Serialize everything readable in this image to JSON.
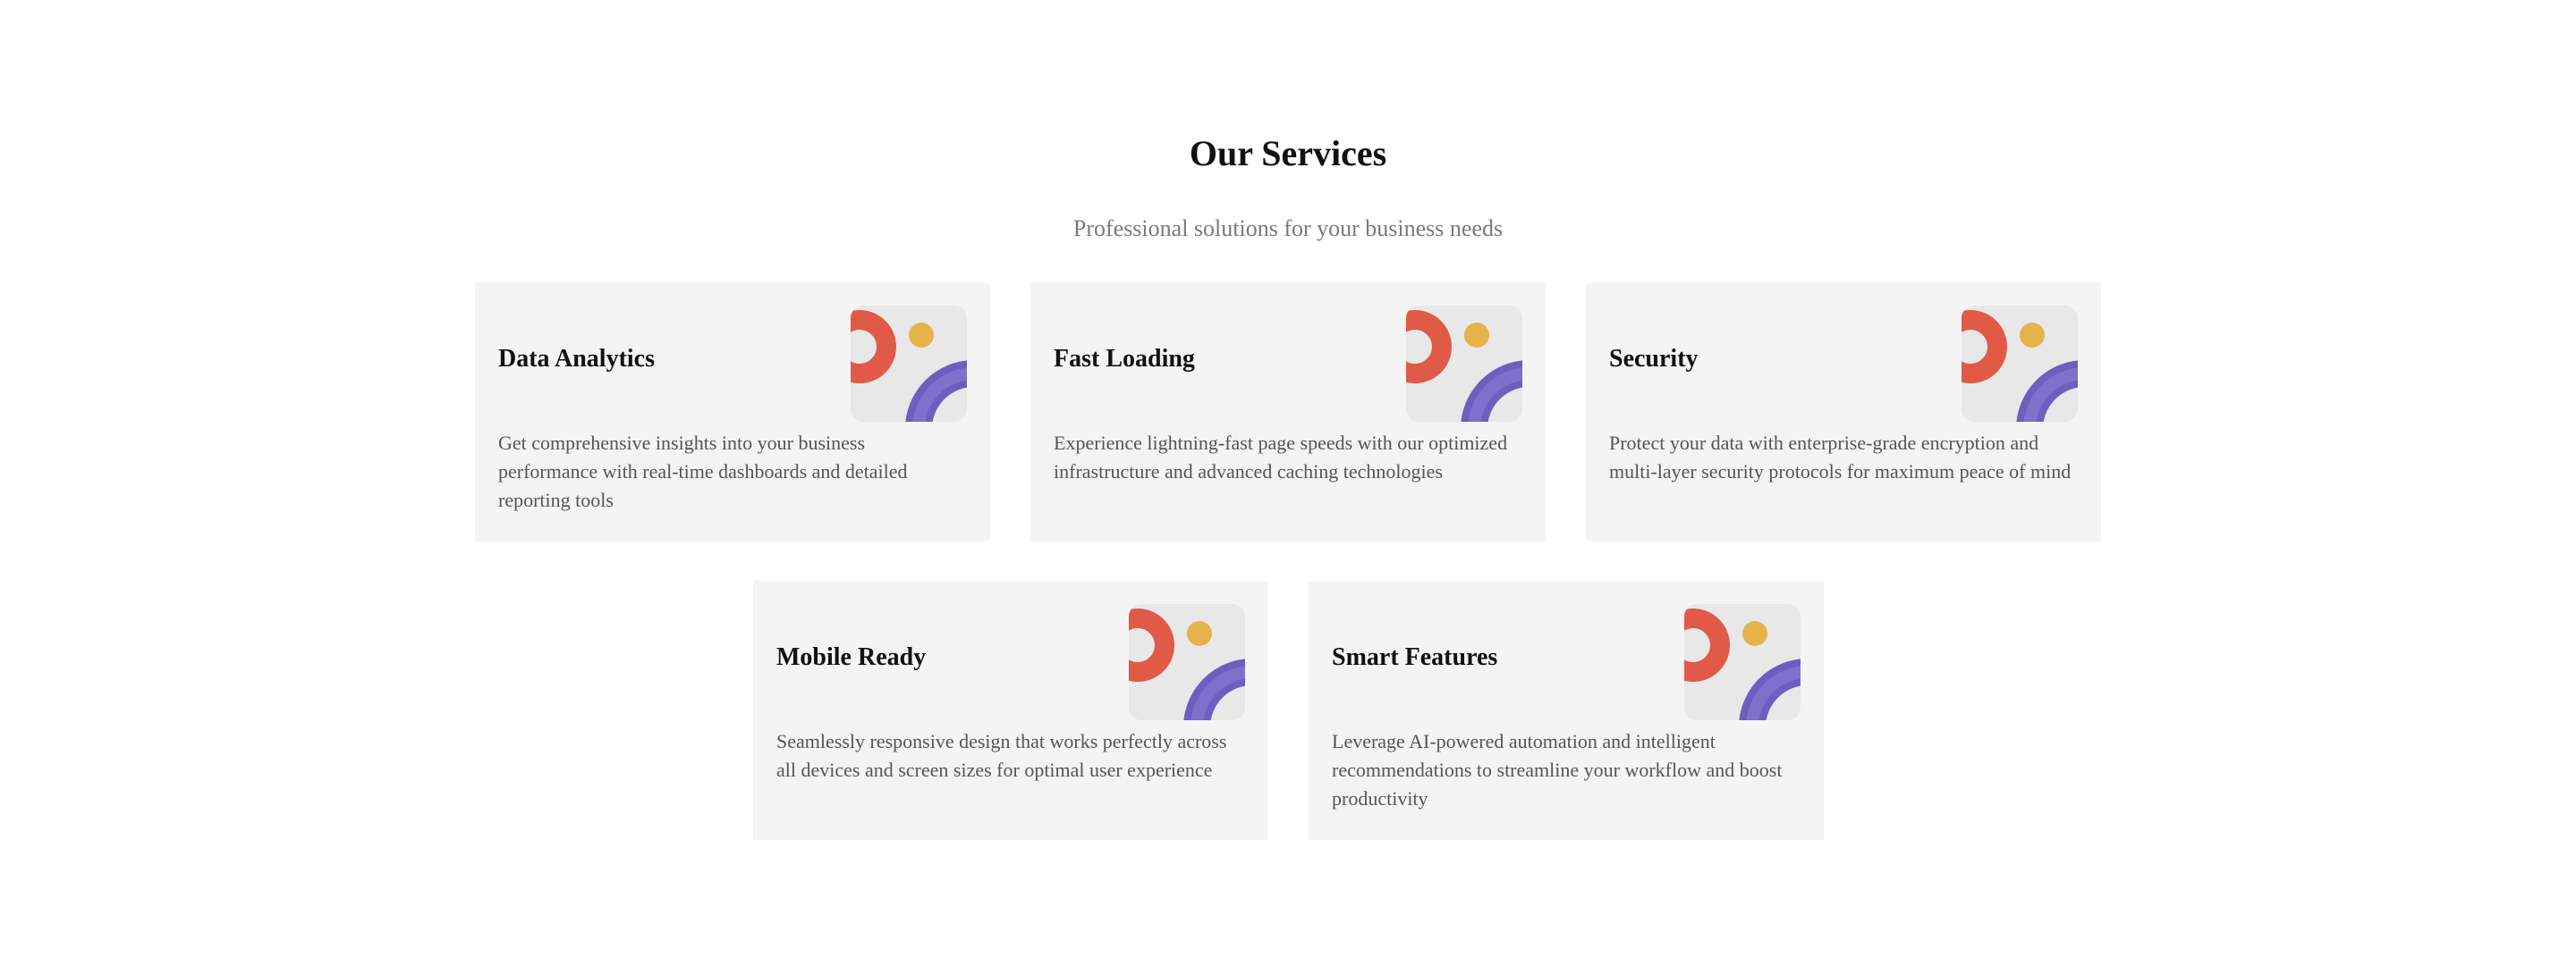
{
  "header": {
    "title": "Our Services",
    "subtitle": "Professional solutions for your business needs"
  },
  "colors": {
    "card_background": "#f4f4f4",
    "icon_background": "#e8e8e8",
    "icon_red": "#e05a47",
    "icon_yellow": "#e6b34a",
    "icon_purple": "#6f5ec0",
    "icon_purple_light": "#8b7fd4"
  },
  "services": [
    {
      "title": "Data Analytics",
      "icon": "abstract-shapes-icon",
      "description": "Get comprehensive insights into your business performance with real-time dashboards and detailed reporting tools"
    },
    {
      "title": "Fast Loading",
      "icon": "abstract-shapes-icon",
      "description": "Experience lightning-fast page speeds with our optimized infrastructure and advanced caching technologies"
    },
    {
      "title": "Security",
      "icon": "abstract-shapes-icon",
      "description": "Protect your data with enterprise-grade encryption and multi-layer security protocols for maximum peace of mind"
    },
    {
      "title": "Mobile Ready",
      "icon": "abstract-shapes-icon",
      "description": "Seamlessly responsive design that works perfectly across all devices and screen sizes for optimal user experience"
    },
    {
      "title": "Smart Features",
      "icon": "abstract-shapes-icon",
      "description": "Leverage AI-powered automation and intelligent recommendations to streamline your workflow and boost productivity"
    }
  ]
}
